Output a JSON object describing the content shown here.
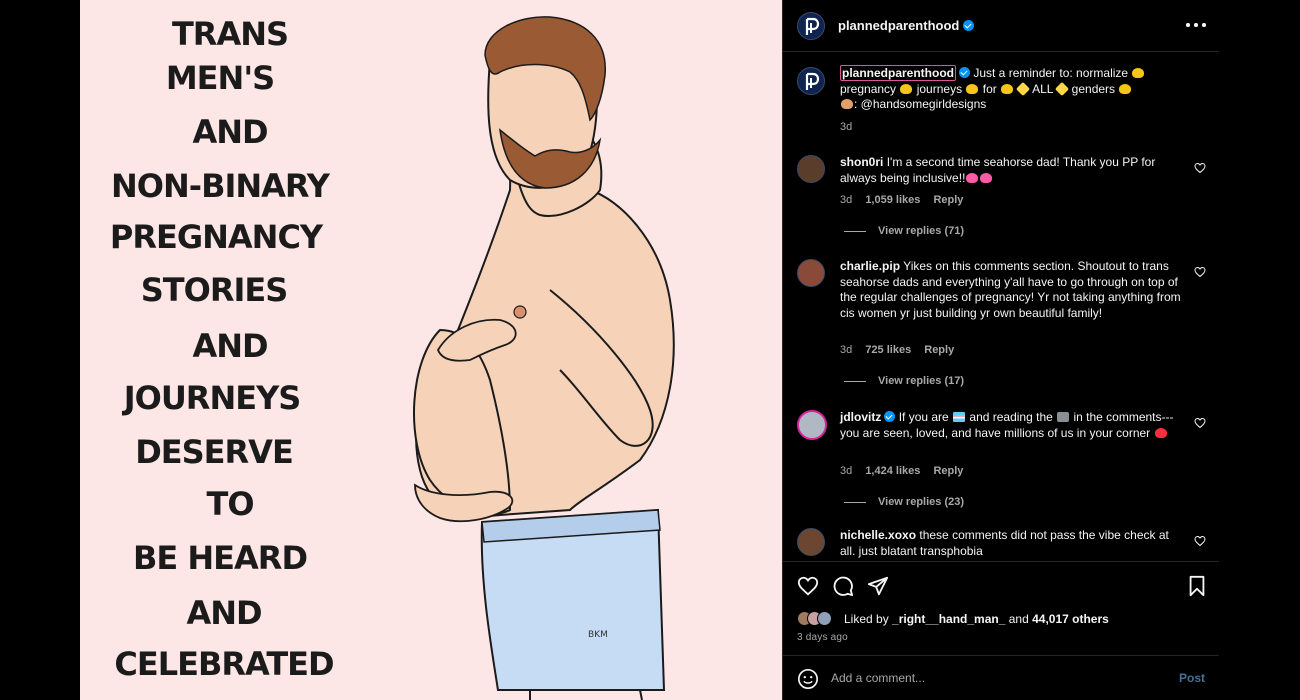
{
  "artwork": {
    "lines": [
      "TRANS",
      "MEN'S",
      "AND",
      "NON-BINARY",
      "PREGNANCY",
      "STORIES",
      "AND",
      "JOURNEYS",
      "DESERVE",
      "TO",
      "BE HEARD",
      "AND",
      "CELEBRATED"
    ],
    "signature": "BKM",
    "colors": {
      "background": "#fce6e6",
      "skin": "#f6d2b8",
      "hair": "#9a5a34",
      "shorts": "#c6dcf5"
    }
  },
  "header": {
    "username": "plannedparenthood",
    "more_icon": "more-horizontal-icon"
  },
  "caption": {
    "username": "plannedparenthood",
    "text_1": "Just a reminder to: normalize ",
    "text_2": "pregnancy ",
    "text_3": " journeys ",
    "text_4": " for ",
    "text_5": " ALL ",
    "text_6": " genders ",
    "text_7": ": @handsomegirldesigns",
    "time": "3d"
  },
  "comments": [
    {
      "username": "shon0ri",
      "text": "I'm a second time seahorse dad! Thank you PP for always being inclusive!!",
      "time": "3d",
      "likes": "1,059 likes",
      "reply": "Reply",
      "view_replies": "View replies (71)"
    },
    {
      "username": "charlie.pip",
      "text": "Yikes on this comments section. Shoutout to trans seahorse dads and everything y'all have to go through on top of the regular challenges of pregnancy! Yr not taking anything from cis women yr just building yr own beautiful family!",
      "time": "3d",
      "likes": "725 likes",
      "reply": "Reply",
      "view_replies": "View replies (17)"
    },
    {
      "username": "jdlovitz",
      "text_1": "If you are ",
      "text_2": " and reading the ",
      "text_3": " in the comments--- you are seen, loved, and have millions of us in your corner ",
      "time": "3d",
      "likes": "1,424 likes",
      "reply": "Reply",
      "view_replies": "View replies (23)"
    },
    {
      "username": "nichelle.xoxo",
      "text": "these comments did not pass the vibe check at all. just blatant transphobia"
    }
  ],
  "likes": {
    "prefix": "Liked by ",
    "user": "_right__hand_man_",
    "middle": " and ",
    "others": "44,017 others",
    "time_ago": "3 days ago"
  },
  "add_comment": {
    "placeholder": "Add a comment...",
    "post_label": "Post"
  },
  "colors": {
    "panel_bg": "#000000",
    "text": "#f5f5f5",
    "muted": "#a8a8a8",
    "verified": "#0095f6",
    "post_button": "#4a6f96"
  }
}
